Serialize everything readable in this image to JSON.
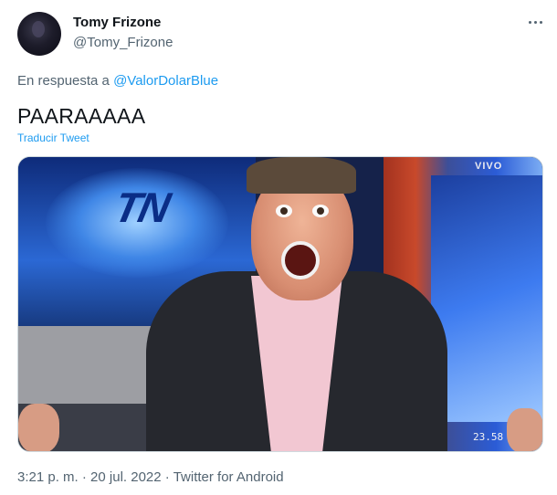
{
  "author": {
    "name": "Tomy Frizone",
    "handle": "@Tomy_Frizone"
  },
  "reply": {
    "prefix": "En respuesta a",
    "mention": "@ValorDolarBlue"
  },
  "tweet": {
    "text": "PAARAAAAA",
    "translate_label": "Traducir Tweet"
  },
  "media": {
    "channel_logo_text": "TN",
    "live_label": "VIVO",
    "clock": "23.58"
  },
  "meta": {
    "time": "3:21 p. m.",
    "separator": "·",
    "date": "20 jul. 2022",
    "source": "Twitter for Android"
  },
  "icons": {
    "more": "more-horizontal-icon"
  },
  "colors": {
    "text": "#0f1419",
    "secondary": "#536471",
    "link": "#1d9bf0"
  }
}
